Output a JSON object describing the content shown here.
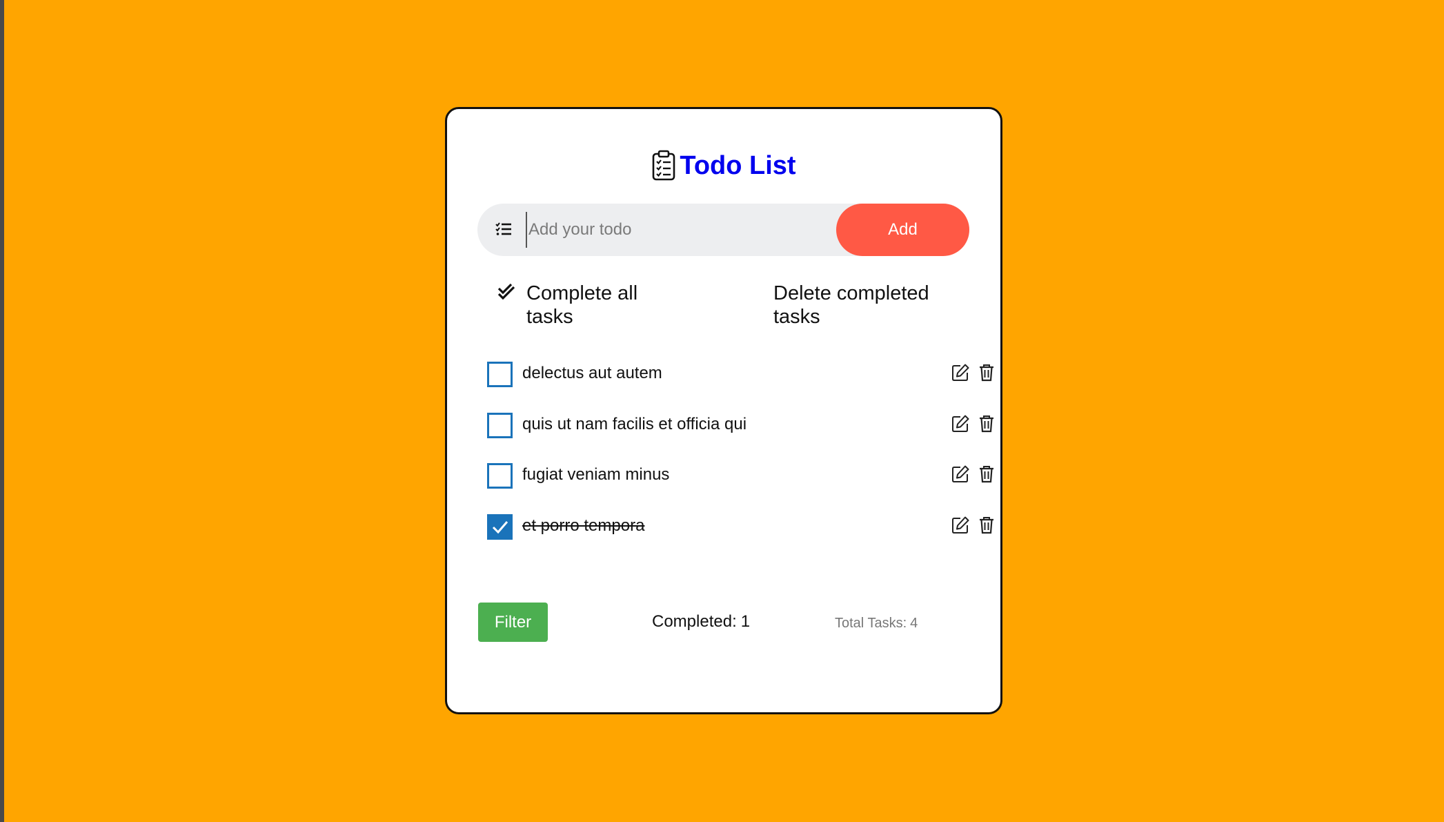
{
  "app": {
    "title": "Todo List"
  },
  "input": {
    "placeholder": "Add your todo",
    "value": ""
  },
  "buttons": {
    "add_label": "Add",
    "complete_all_label": "Complete all tasks",
    "delete_completed_label": "Delete completed tasks",
    "filter_label": "Filter"
  },
  "todos": [
    {
      "text": "delectus aut autem",
      "completed": false
    },
    {
      "text": "quis ut nam facilis et officia qui",
      "completed": false
    },
    {
      "text": "fugiat veniam minus",
      "completed": false
    },
    {
      "text": "et porro tempora",
      "completed": true
    }
  ],
  "stats": {
    "completed_label": "Completed:",
    "completed_value": "1",
    "total_label": "Total Tasks:",
    "total_value": "4"
  },
  "colors": {
    "background": "#FFA500",
    "title": "#0000EE",
    "add_button": "#FF5945",
    "filter_button": "#4CAF50",
    "checkbox": "#1A73BA"
  },
  "icons": {
    "title": "clipboard-list-icon",
    "input": "list-check-icon",
    "complete_all": "double-check-icon",
    "edit": "edit-icon",
    "delete": "trash-icon"
  }
}
